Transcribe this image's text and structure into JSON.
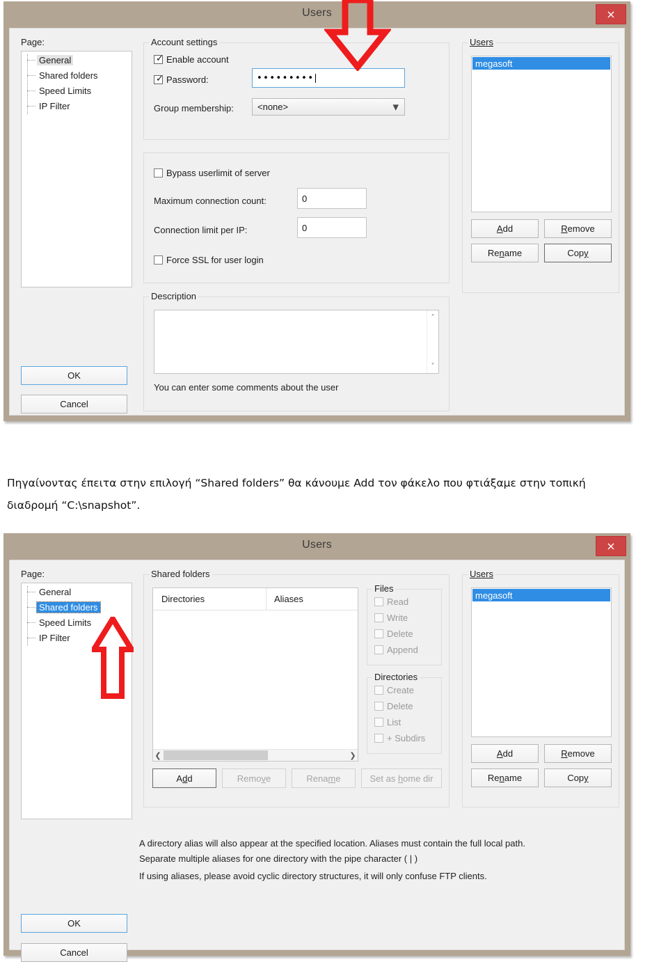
{
  "dialog1": {
    "title": "Users",
    "close_label": "×",
    "page_label": "Page:",
    "page_items": [
      {
        "label": "General",
        "state": "selected-gray"
      },
      {
        "label": "Shared folders",
        "state": "normal"
      },
      {
        "label": "Speed Limits",
        "state": "normal"
      },
      {
        "label": "IP Filter",
        "state": "normal"
      }
    ],
    "account_settings": {
      "group_label": "Account settings",
      "enable_account": {
        "label": "Enable account",
        "checked": true
      },
      "password": {
        "label": "Password:",
        "checked": true,
        "value": "•••••••••"
      },
      "group_membership": {
        "label": "Group membership:",
        "value": "<none>"
      }
    },
    "limits": {
      "bypass_userlimit": {
        "label": "Bypass userlimit of server",
        "checked": false
      },
      "max_connection_count": {
        "label": "Maximum connection count:",
        "value": "0"
      },
      "connection_limit_per_ip": {
        "label": "Connection limit per IP:",
        "value": "0"
      },
      "force_ssl": {
        "label": "Force SSL for user login",
        "checked": false
      }
    },
    "description": {
      "group_label": "Description",
      "value": "",
      "hint": "You can enter some comments about the user"
    },
    "users_panel": {
      "group_label": "Users",
      "items": [
        "megasoft"
      ],
      "selected": "megasoft",
      "buttons": {
        "add": "Add",
        "remove": "Remove",
        "rename": "Rename",
        "copy": "Copy"
      }
    },
    "ok_label": "OK",
    "cancel_label": "Cancel"
  },
  "caption": {
    "line1": "Πηγαίνοντας έπειτα στην επιλογή “Shared folders” θα κάνουμε Add τον φάκελο που φτιάξαμε στην τοπική",
    "line2": "διαδρομή “C:\\snapshot”."
  },
  "dialog2": {
    "title": "Users",
    "close_label": "×",
    "page_label": "Page:",
    "page_items": [
      {
        "label": "General",
        "state": "normal"
      },
      {
        "label": "Shared folders",
        "state": "selected-blue"
      },
      {
        "label": "Speed Limits",
        "state": "normal"
      },
      {
        "label": "IP Filter",
        "state": "normal"
      }
    ],
    "shared_folders": {
      "group_label": "Shared folders",
      "columns": [
        "Directories",
        "Aliases"
      ],
      "rows": [],
      "buttons": {
        "add": "Add",
        "remove": "Remove",
        "rename": "Rename",
        "set_home": "Set as home dir"
      }
    },
    "files_group": {
      "group_label": "Files",
      "items": [
        {
          "label": "Read",
          "checked": false
        },
        {
          "label": "Write",
          "checked": false
        },
        {
          "label": "Delete",
          "checked": false
        },
        {
          "label": "Append",
          "checked": false
        }
      ]
    },
    "directories_group": {
      "group_label": "Directories",
      "items": [
        {
          "label": "Create",
          "checked": false
        },
        {
          "label": "Delete",
          "checked": false
        },
        {
          "label": "List",
          "checked": false
        },
        {
          "label": "+ Subdirs",
          "checked": false
        }
      ]
    },
    "users_panel": {
      "group_label": "Users",
      "items": [
        "megasoft"
      ],
      "selected": "megasoft",
      "buttons": {
        "add": "Add",
        "remove": "Remove",
        "rename": "Rename",
        "copy": "Copy"
      }
    },
    "help_text": {
      "p1": "A directory alias will also appear at the specified location. Aliases must contain the full local path. Separate multiple aliases for one directory with the pipe character ( | )",
      "p2": "If using aliases, please avoid cyclic directory structures, it will only confuse FTP clients."
    },
    "ok_label": "OK",
    "cancel_label": "Cancel"
  },
  "colors": {
    "window_frame": "#b3a593",
    "client_bg": "#f0f0f0",
    "close_red": "#c44444",
    "selection_blue": "#2f8de4",
    "arrow_red": "#ee1c1c",
    "focus_blue": "#5ba5e0"
  }
}
